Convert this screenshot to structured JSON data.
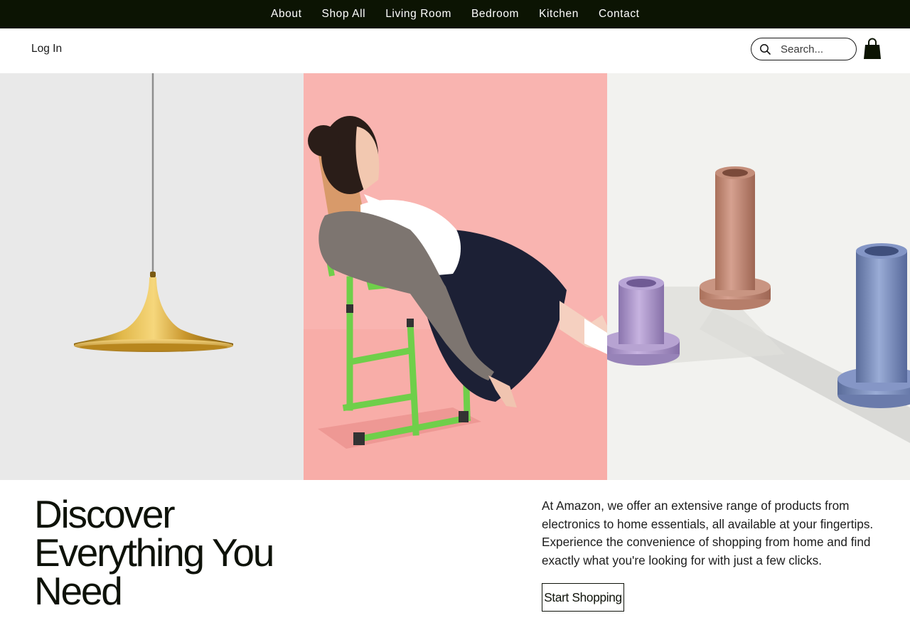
{
  "nav": {
    "items": [
      {
        "label": "About"
      },
      {
        "label": "Shop All"
      },
      {
        "label": "Living Room"
      },
      {
        "label": "Bedroom"
      },
      {
        "label": "Kitchen"
      },
      {
        "label": "Contact"
      }
    ]
  },
  "header": {
    "login_label": "Log In",
    "search_placeholder": "Search...",
    "search_icon": "search-icon",
    "cart_icon": "shopping-bag-icon"
  },
  "hero": {
    "images": [
      {
        "name": "gold-pendant-lamp-image"
      },
      {
        "name": "girl-on-green-chair-image"
      },
      {
        "name": "ceramic-candle-holders-image"
      }
    ]
  },
  "main": {
    "headline": "Discover Everything You Need",
    "description": "At Amazon, we offer an extensive range of products from electronics to home essentials, all available at your fingertips. Experience the convenience of shopping from home and find exactly what you're looking for with just a few clicks.",
    "cta_label": "Start Shopping"
  },
  "colors": {
    "nav_background": "#0c1403",
    "text_primary": "#0e1209",
    "panel_lamp_bg": "#e9e9e9",
    "panel_chair_bg": "#f9b4b0",
    "panel_vases_bg": "#f2f2ef"
  }
}
